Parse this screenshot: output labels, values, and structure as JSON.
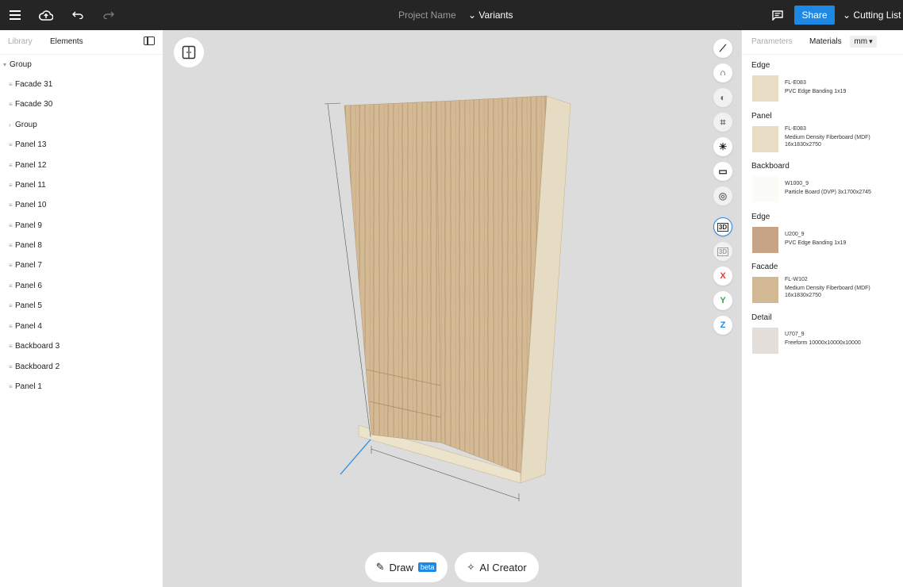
{
  "topbar": {
    "project_name": "Project Name",
    "variants": "Variants",
    "share": "Share",
    "cutting_list": "Cutting List"
  },
  "left": {
    "tabs": [
      "Library",
      "Elements"
    ],
    "tree": [
      {
        "label": "Group",
        "mark": "▾"
      },
      {
        "label": "Facade 31",
        "mark": "≡"
      },
      {
        "label": "Facade 30",
        "mark": "≡"
      },
      {
        "label": "Group",
        "mark": "›"
      },
      {
        "label": "Panel 13",
        "mark": "≡"
      },
      {
        "label": "Panel 12",
        "mark": "≡"
      },
      {
        "label": "Panel 11",
        "mark": "≡"
      },
      {
        "label": "Panel 10",
        "mark": "≡"
      },
      {
        "label": "Panel 9",
        "mark": "≡"
      },
      {
        "label": "Panel 8",
        "mark": "≡"
      },
      {
        "label": "Panel 7",
        "mark": "≡"
      },
      {
        "label": "Panel 6",
        "mark": "≡"
      },
      {
        "label": "Panel 5",
        "mark": "≡"
      },
      {
        "label": "Panel 4",
        "mark": "≡"
      },
      {
        "label": "Backboard 3",
        "mark": "≡"
      },
      {
        "label": "Backboard 2",
        "mark": "≡"
      },
      {
        "label": "Panel 1",
        "mark": "≡"
      }
    ]
  },
  "canvas": {
    "axis_buttons": [
      "X",
      "Y",
      "Z"
    ],
    "draw_label": "Draw",
    "beta_label": "beta",
    "ai_label": "AI Creator"
  },
  "right": {
    "tabs": [
      "Parameters",
      "Materials"
    ],
    "unit": "mm",
    "materials": [
      {
        "category": "Edge",
        "code": "FL-E083",
        "desc": "PVC Edge Banding 1x19",
        "color": "#e8dcc4"
      },
      {
        "category": "Panel",
        "code": "FL-E083",
        "desc": "Medium Density Fiberboard (MDF) 16x1830x2750",
        "color": "#e8dcc4"
      },
      {
        "category": "Backboard",
        "code": "W1000_9",
        "desc": "Particle Board (DVP) 3x1700x2745",
        "color": "#fbfbf7"
      },
      {
        "category": "Edge",
        "code": "U200_9",
        "desc": "PVC Edge Banding 1x19",
        "color": "#c8a486"
      },
      {
        "category": "Facade",
        "code": "FL-W102",
        "desc": "Medium Density Fiberboard (MDF) 16x1830x2750",
        "color": "#d2b893"
      },
      {
        "category": "Detail",
        "code": "U707_9",
        "desc": "Freeform 10000x10000x10000",
        "color": "#e3ded9"
      }
    ]
  }
}
